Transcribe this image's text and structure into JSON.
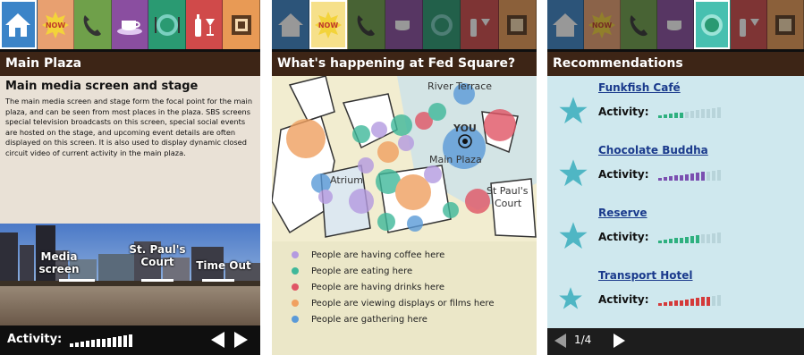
{
  "tabs": [
    {
      "icon": "home-icon"
    },
    {
      "icon": "now-icon",
      "text": "NOW"
    },
    {
      "icon": "phone-icon"
    },
    {
      "icon": "coffee-icon"
    },
    {
      "icon": "dining-icon"
    },
    {
      "icon": "drinks-icon"
    },
    {
      "icon": "display-screen-icon"
    }
  ],
  "screen1": {
    "header": "Main Plaza",
    "subtitle": "Main media screen and stage",
    "paragraph": "The main media screen and stage form the focal point for the main plaza, and can be seen from most places in the plaza. SBS screens special television broadcasts on this screen, special social events are hosted on the stage, and upcoming event details are often displayed on this screen. It is also used to display dynamic closed circuit video of current activity in the main plaza.",
    "photo_labels": {
      "media": "Media screen",
      "stpauls": "St. Paul's Court",
      "timeout": "Time Out"
    },
    "activity_label": "Activity:",
    "activity_level": 1.0,
    "active_tab": 0
  },
  "screen2": {
    "header": "What's happening at Fed Square?",
    "map_labels": {
      "river_terrace": "River Terrace",
      "you": "YOU",
      "main_plaza": "Main Plaza",
      "atrium": "Atrium",
      "st_pauls": "St Paul's",
      "court": "Court"
    },
    "legend": [
      {
        "color": "#b49ae0",
        "text": "People are having coffee here"
      },
      {
        "color": "#3fb89a",
        "text": "People are eating here"
      },
      {
        "color": "#e05565",
        "text": "People are having drinks here"
      },
      {
        "color": "#f0a060",
        "text": "People are viewing displays or films here"
      },
      {
        "color": "#5a9ad8",
        "text": "People are gathering here"
      }
    ],
    "active_tab": 1
  },
  "screen3": {
    "header": "Recommendations",
    "items": [
      {
        "name": "Funkfish Café",
        "activity_label": "Activity:",
        "level": 0.4,
        "color": "#2eb07f",
        "star": "star-icon"
      },
      {
        "name": "Chocolate Buddha",
        "activity_label": "Activity:",
        "level": 0.75,
        "color": "#7b4fb0",
        "star": "star-icon"
      },
      {
        "name": "Reserve",
        "activity_label": "Activity:",
        "level": 0.7,
        "color": "#2eb07f",
        "star": "star-icon"
      },
      {
        "name": "Transport Hotel",
        "activity_label": "Activity:",
        "level": 0.8,
        "color": "#d43a3a",
        "star": "star-icon"
      }
    ],
    "pager": "1/4",
    "active_tab": 4
  },
  "colors": {
    "header_bg": "#3d2516",
    "accent_blue": "#2f7fc5",
    "star_teal": "#4fb6c4"
  }
}
